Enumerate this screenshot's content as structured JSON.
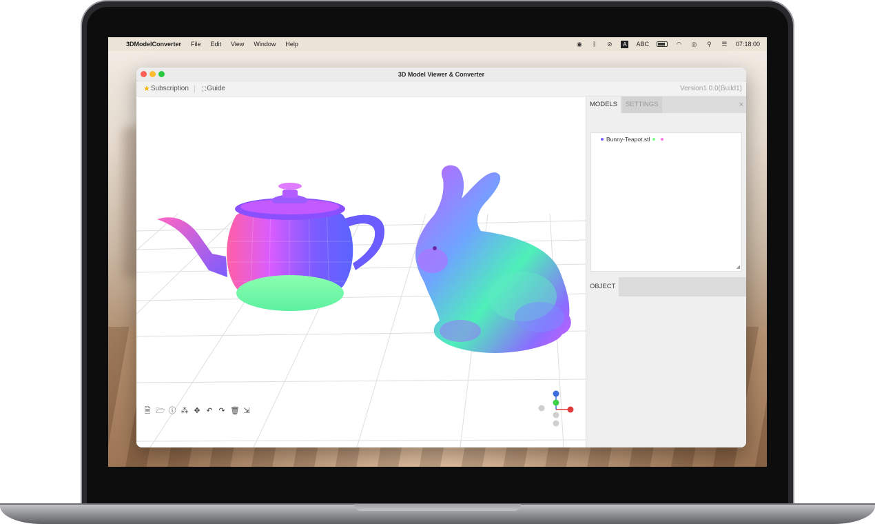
{
  "menubar": {
    "app_name": "3DModelConverter",
    "menus": [
      "File",
      "Edit",
      "View",
      "Window",
      "Help"
    ],
    "lang": "ABC",
    "lang_badge": "A",
    "clock": "07:18:00"
  },
  "window": {
    "title": "3D Model Viewer & Converter"
  },
  "toolbar": {
    "subscription_label": "Subscription",
    "guide_label": "Guide",
    "version": "Version1.0.0(Build1)"
  },
  "panel": {
    "tabs": [
      "MODELS",
      "SETTINGS"
    ],
    "close_label": "×",
    "object_tab": "OBJECT",
    "models": [
      {
        "name": "Bunny-Teapot.stl",
        "dot_colors": [
          "#7b5cff",
          "#7dff8a",
          "#ff7be6"
        ]
      }
    ]
  },
  "colors": {
    "accent_close": "#fe5f57",
    "accent_min": "#febc2e",
    "accent_max": "#28c840"
  },
  "icons": {
    "bottom_tools": [
      "new-file-icon",
      "open-folder-icon",
      "info-icon",
      "material-icon",
      "move-icon",
      "undo-icon",
      "redo-icon",
      "delete-icon",
      "export-icon"
    ]
  }
}
